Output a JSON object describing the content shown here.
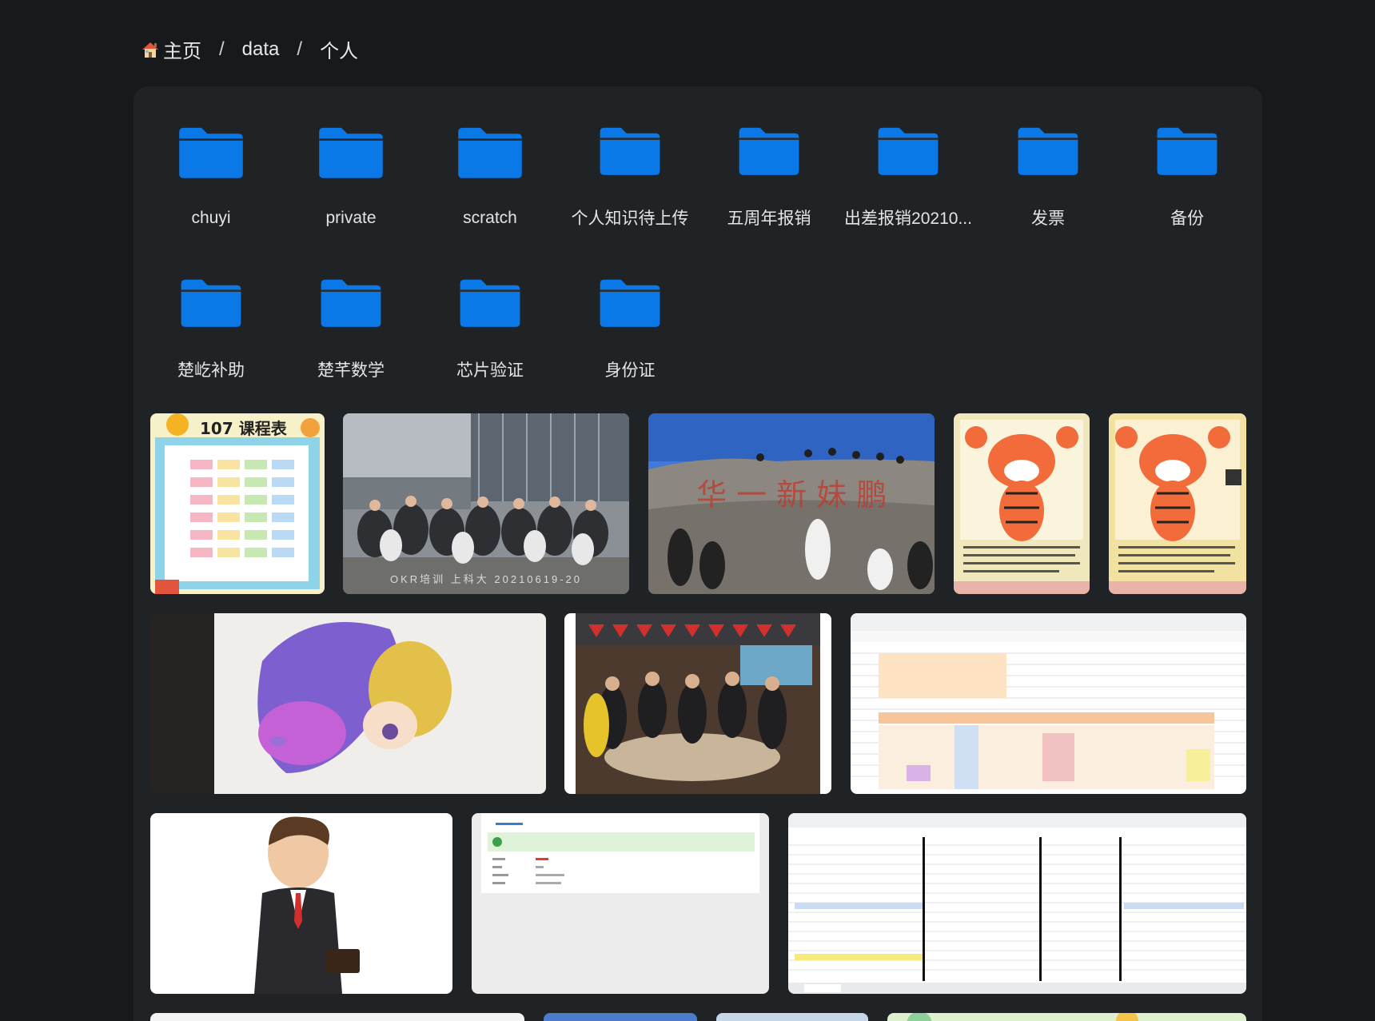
{
  "breadcrumb": {
    "home_label": "主页",
    "items": [
      "data",
      "个人"
    ],
    "separator": "/"
  },
  "folders": [
    {
      "name": "chuyi"
    },
    {
      "name": "private"
    },
    {
      "name": "scratch"
    },
    {
      "name": "个人知识待上传"
    },
    {
      "name": "五周年报销"
    },
    {
      "name": "出差报销20210..."
    },
    {
      "name": "发票"
    },
    {
      "name": "备份"
    },
    {
      "name": "楚屹补助"
    },
    {
      "name": "楚芊数学"
    },
    {
      "name": "芯片验证"
    },
    {
      "name": "身份证"
    }
  ],
  "thumbnails": [
    {
      "kind": "schedule-poster",
      "title_text": "107 课程表",
      "caption": ""
    },
    {
      "kind": "group-photo-building",
      "caption": "OKR培训  上科大  20210619-20"
    },
    {
      "kind": "rock-inscription-photo",
      "caption": ""
    },
    {
      "kind": "tiger-drawing",
      "caption": ""
    },
    {
      "kind": "tiger-drawing",
      "caption": ""
    },
    {
      "kind": "princess-drawing",
      "caption": ""
    },
    {
      "kind": "dinner-party-photo",
      "caption": ""
    },
    {
      "kind": "spreadsheet-screenshot",
      "caption": ""
    },
    {
      "kind": "businessman-cartoon",
      "caption": ""
    },
    {
      "kind": "form-screenshot",
      "caption": ""
    },
    {
      "kind": "spreadsheet-screenshot",
      "caption": ""
    }
  ],
  "colors": {
    "background": "#17191c",
    "panel": "#202326",
    "folder_blue": "#0a78e6"
  }
}
